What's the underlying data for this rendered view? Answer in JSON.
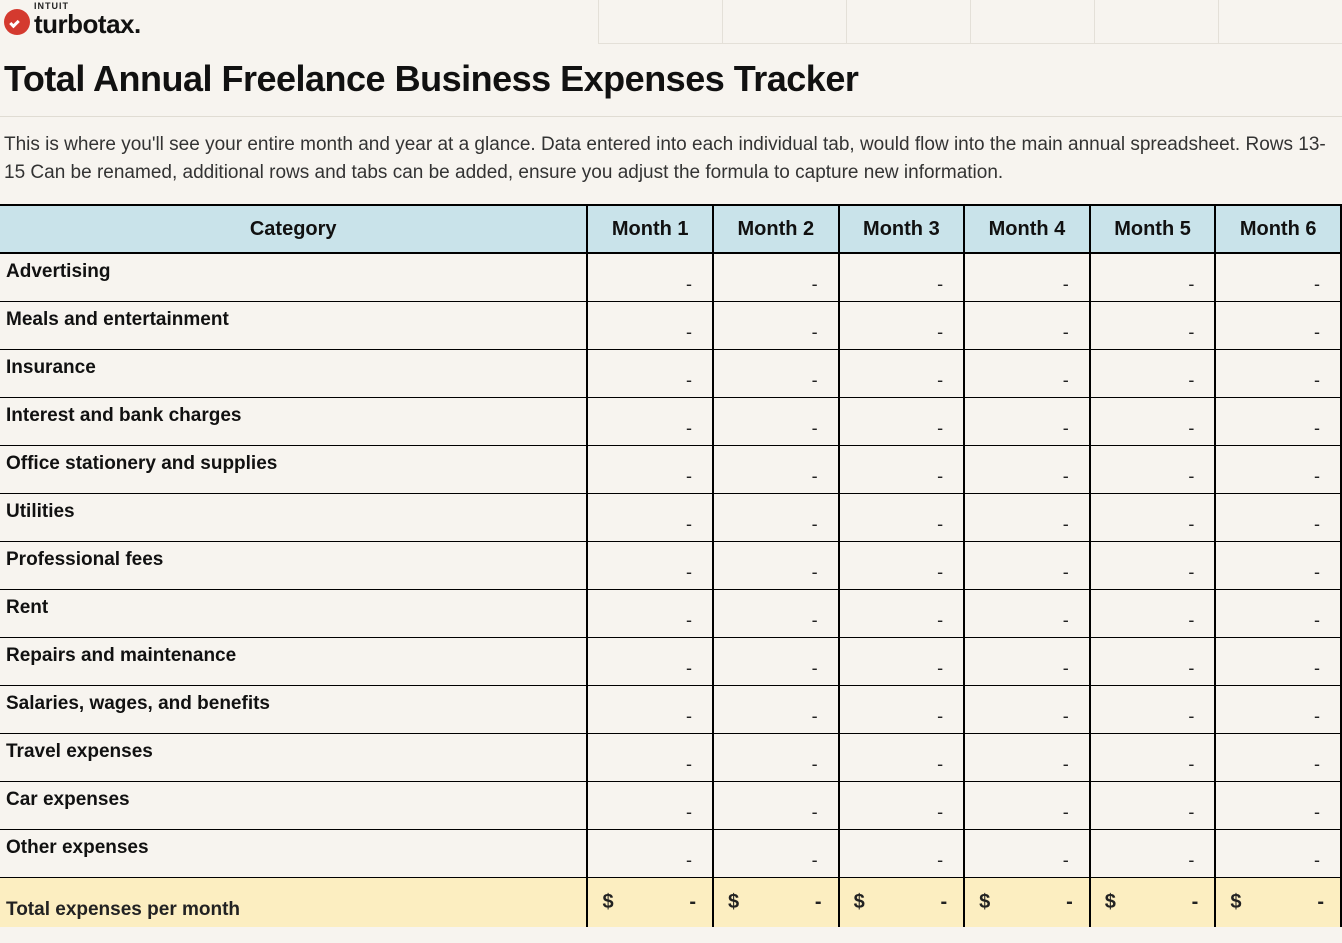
{
  "logo": {
    "intuit": "INTUIT",
    "product": "turbotax."
  },
  "title": "Total Annual Freelance Business Expenses Tracker",
  "description": "This is where you'll see your entire month and year at a glance. Data entered into each individual tab, would flow into the main annual spreadsheet. Rows 13-15 Can be renamed, additional rows and tabs can be added, ensure you adjust the formula to capture new information.",
  "header": {
    "category": "Category",
    "months": [
      "Month 1",
      "Month 2",
      "Month 3",
      "Month 4",
      "Month 5",
      "Month 6"
    ]
  },
  "categories": [
    "Advertising",
    "Meals and entertainment",
    "Insurance",
    "Interest and bank charges",
    "Office stationery and supplies",
    "Utilities",
    "Professional fees",
    "Rent",
    "Repairs and maintenance",
    "Salaries, wages, and benefits",
    "Travel expenses",
    "Car expenses",
    "Other expenses"
  ],
  "cell_placeholder": "-",
  "total": {
    "label": "Total expenses per month",
    "currency": "$",
    "value": "-"
  }
}
